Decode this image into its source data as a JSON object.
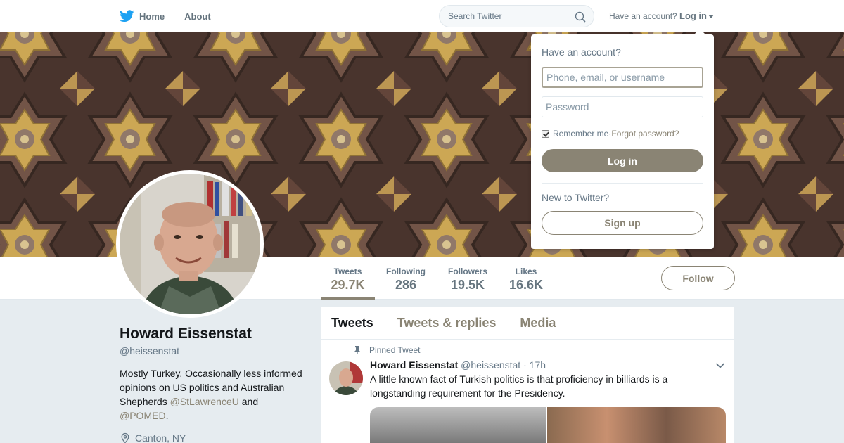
{
  "nav": {
    "home_label": "Home",
    "about_label": "About",
    "search_placeholder": "Search Twitter",
    "have_account_text": "Have an account?",
    "login_label": "Log in"
  },
  "login_dropdown": {
    "title": "Have an account?",
    "username_placeholder": "Phone, email, or username",
    "password_placeholder": "Password",
    "remember_label": "Remember me",
    "separator": " · ",
    "forgot_label": "Forgot password?",
    "remember_checked": true,
    "login_button": "Log in",
    "new_to_twitter": "New to Twitter?",
    "signup_button": "Sign up"
  },
  "profile": {
    "name": "Howard Eissenstat",
    "handle": "@heissenstat",
    "bio_text_1": "Mostly Turkey. Occasionally less informed opinions on US politics and Australian Shepherds ",
    "bio_mention_1": "@StLawrenceU",
    "bio_text_2": " and ",
    "bio_mention_2": "@POMED",
    "bio_text_3": ".",
    "location": "Canton, NY"
  },
  "stats": [
    {
      "label": "Tweets",
      "value": "29.7K",
      "active": true
    },
    {
      "label": "Following",
      "value": "286",
      "active": false
    },
    {
      "label": "Followers",
      "value": "19.5K",
      "active": false
    },
    {
      "label": "Likes",
      "value": "16.6K",
      "active": false
    }
  ],
  "follow_button": "Follow",
  "timeline": {
    "tabs": [
      {
        "label": "Tweets",
        "active": true
      },
      {
        "label": "Tweets & replies",
        "active": false
      },
      {
        "label": "Media",
        "active": false
      }
    ],
    "pinned_label": "Pinned Tweet",
    "tweet": {
      "name": "Howard Eissenstat",
      "handle": "@heissenstat",
      "separator": " · ",
      "time": "17h",
      "text": "A little known fact of Turkish politics is that proficiency in billiards is a longstanding requirement for the Presidency."
    }
  },
  "colors": {
    "accent": "#8a8474",
    "twitter_blue": "#1da1f2",
    "background": "#e6ecf0"
  },
  "icons": {
    "logo": "twitter-bird-icon",
    "search": "search-icon",
    "location": "location-pin-icon",
    "pinned": "pin-icon",
    "tweet_menu": "chevron-down-icon"
  }
}
